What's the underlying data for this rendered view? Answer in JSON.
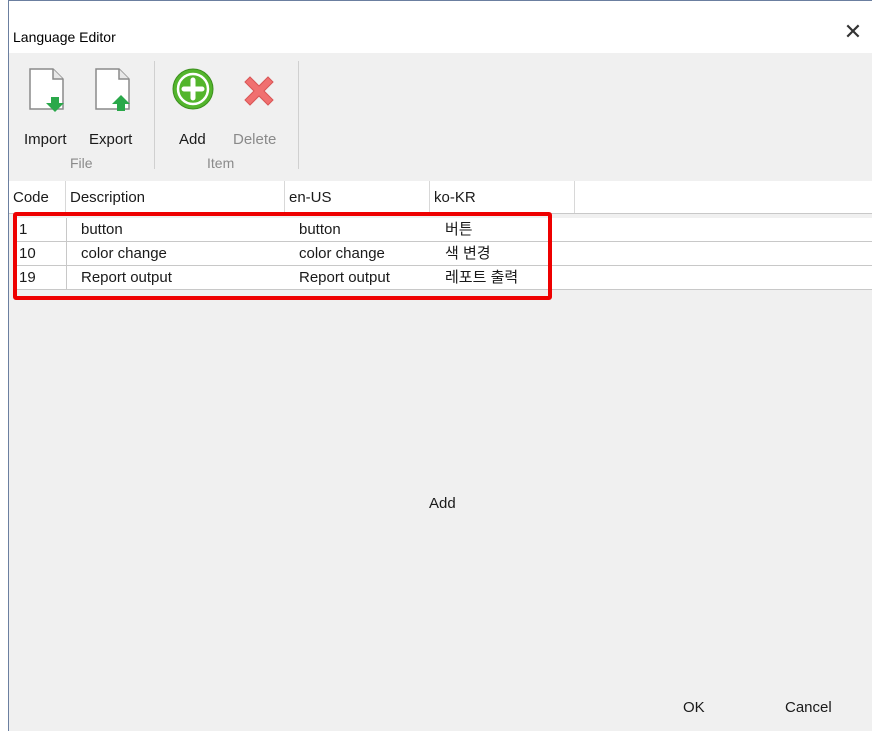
{
  "window": {
    "title": "Language Editor",
    "close_glyph": "✕"
  },
  "ribbon": {
    "buttons": {
      "import": {
        "label": "Import",
        "icon": "import-document-icon",
        "color": "#2aa84a"
      },
      "export": {
        "label": "Export",
        "icon": "export-document-icon",
        "color": "#2aa84a"
      },
      "add": {
        "label": "Add",
        "icon": "add-circle-icon",
        "color": "#53b52c"
      },
      "delete": {
        "label": "Delete",
        "icon": "delete-x-icon",
        "color": "#f07070"
      }
    },
    "groups": {
      "file": "File",
      "item": "Item"
    }
  },
  "grid": {
    "columns": [
      "Code",
      "Description",
      "en-US",
      "ko-KR"
    ],
    "rows": [
      {
        "code": "1",
        "description": "button",
        "en_us": "button",
        "ko_kr": "버튼"
      },
      {
        "code": "10",
        "description": "color change",
        "en_us": "color change",
        "ko_kr": "색 변경"
      },
      {
        "code": "19",
        "description": "Report output",
        "en_us": "Report output",
        "ko_kr": "레포트 출력"
      }
    ],
    "add_row_label": "Add",
    "highlight_color": "#ee0000"
  },
  "footer": {
    "ok_label": "OK",
    "cancel_label": "Cancel"
  }
}
